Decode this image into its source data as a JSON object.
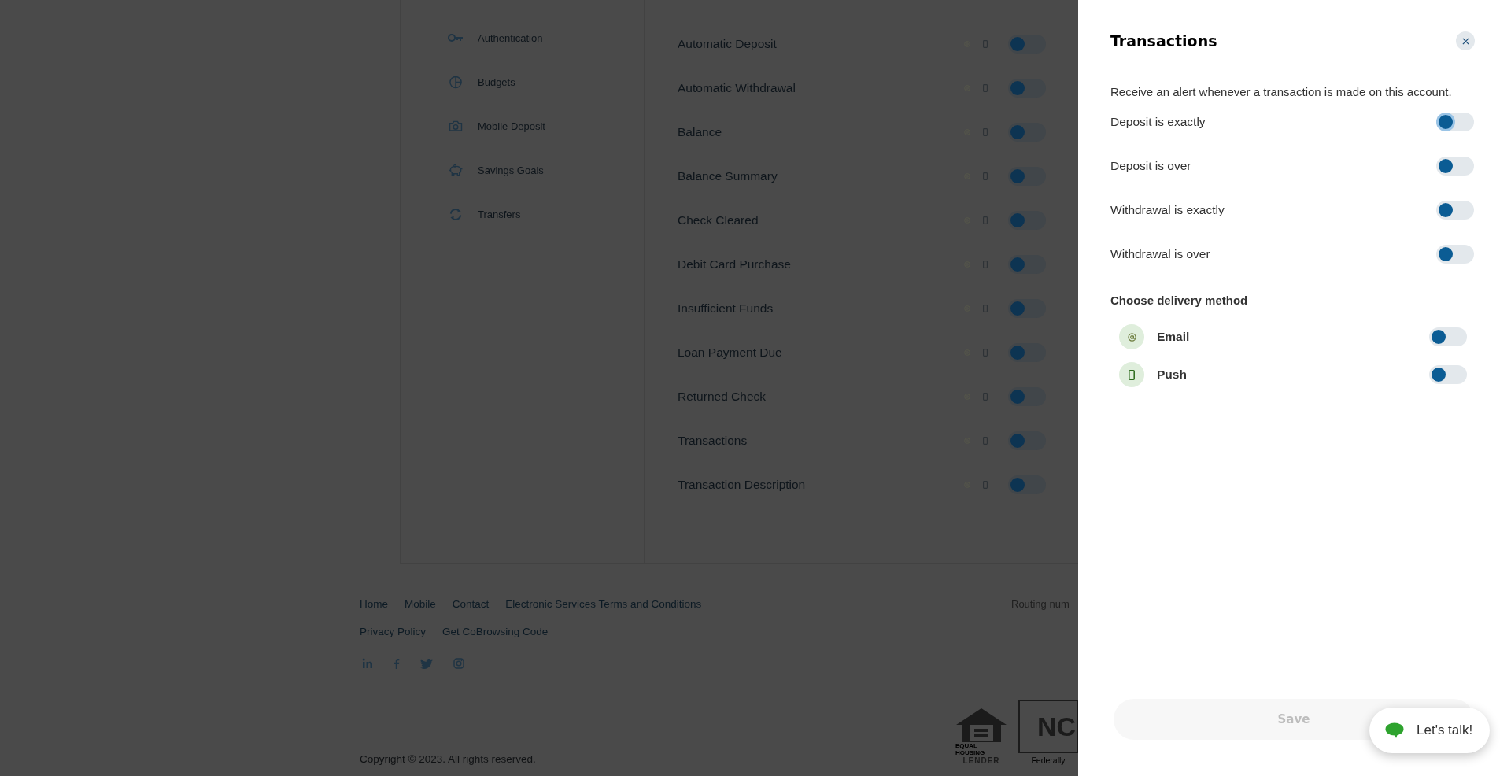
{
  "sidebar": {
    "items": [
      {
        "label": "Authentication"
      },
      {
        "label": "Budgets"
      },
      {
        "label": "Mobile Deposit"
      },
      {
        "label": "Savings Goals"
      },
      {
        "label": "Transfers"
      }
    ]
  },
  "alerts": {
    "rows": [
      {
        "label": "Automatic Deposit",
        "on": false
      },
      {
        "label": "Automatic Withdrawal",
        "on": false
      },
      {
        "label": "Balance",
        "on": false
      },
      {
        "label": "Balance Summary",
        "on": false
      },
      {
        "label": "Check Cleared",
        "on": false
      },
      {
        "label": "Debit Card Purchase",
        "on": false
      },
      {
        "label": "Insufficient Funds",
        "on": false
      },
      {
        "label": "Loan Payment Due",
        "on": false
      },
      {
        "label": "Returned Check",
        "on": false
      },
      {
        "label": "Transactions",
        "on": false
      },
      {
        "label": "Transaction Description",
        "on": false
      }
    ]
  },
  "footer": {
    "links": [
      "Home",
      "Mobile",
      "Contact",
      "Electronic Services Terms and Conditions"
    ],
    "links_2": [
      "Privacy Policy",
      "Get CoBrowsing Code"
    ],
    "copyright": "Copyright © 2023. All rights reserved.",
    "routing": "Routing num",
    "housing_logo": [
      "EQUAL HOUSING",
      "LENDER"
    ],
    "ncua_logo": {
      "mark": "NC",
      "caption": "Federally"
    }
  },
  "panel": {
    "title": "Transactions",
    "description": "Receive an alert whenever a transaction is made on this account.",
    "options": [
      {
        "label": "Deposit is exactly",
        "on": false,
        "focused": true
      },
      {
        "label": "Deposit is over",
        "on": false,
        "focused": false
      },
      {
        "label": "Withdrawal is exactly",
        "on": false,
        "focused": false
      },
      {
        "label": "Withdrawal is over",
        "on": false,
        "focused": false
      }
    ],
    "delivery_heading": "Choose delivery method",
    "delivery": [
      {
        "label": "Email",
        "on": false
      },
      {
        "label": "Push",
        "on": false
      }
    ],
    "save": {
      "label": "Save",
      "disabled": true
    },
    "chat": {
      "label": "Let's talk!"
    }
  }
}
